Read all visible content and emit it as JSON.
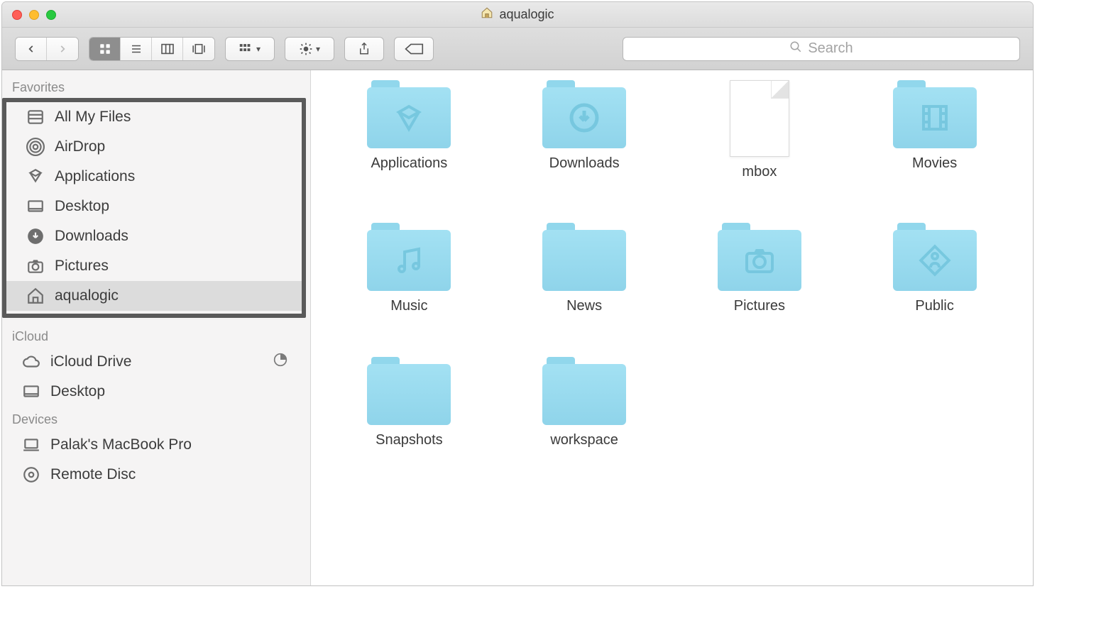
{
  "window": {
    "title": "aqualogic"
  },
  "toolbar": {
    "search_placeholder": "Search"
  },
  "sidebar": {
    "sections": {
      "favorites": {
        "header": "Favorites",
        "items": [
          {
            "label": "All My Files"
          },
          {
            "label": "AirDrop"
          },
          {
            "label": "Applications"
          },
          {
            "label": "Desktop"
          },
          {
            "label": "Downloads"
          },
          {
            "label": "Pictures"
          },
          {
            "label": "aqualogic"
          }
        ]
      },
      "icloud": {
        "header": "iCloud",
        "items": [
          {
            "label": "iCloud Drive"
          },
          {
            "label": "Desktop"
          }
        ]
      },
      "devices": {
        "header": "Devices",
        "items": [
          {
            "label": "Palak's MacBook Pro"
          },
          {
            "label": "Remote Disc"
          }
        ]
      }
    }
  },
  "main": {
    "items": [
      {
        "label": "Applications",
        "type": "folder",
        "glyph": "apps"
      },
      {
        "label": "Downloads",
        "type": "folder",
        "glyph": "download"
      },
      {
        "label": "mbox",
        "type": "file",
        "glyph": "file"
      },
      {
        "label": "Movies",
        "type": "folder",
        "glyph": "movie"
      },
      {
        "label": "Music",
        "type": "folder",
        "glyph": "music"
      },
      {
        "label": "News",
        "type": "folder",
        "glyph": "plain"
      },
      {
        "label": "Pictures",
        "type": "folder",
        "glyph": "camera"
      },
      {
        "label": "Public",
        "type": "folder",
        "glyph": "public"
      },
      {
        "label": "Snapshots",
        "type": "folder",
        "glyph": "plain"
      },
      {
        "label": "workspace",
        "type": "folder",
        "glyph": "plain"
      }
    ]
  }
}
